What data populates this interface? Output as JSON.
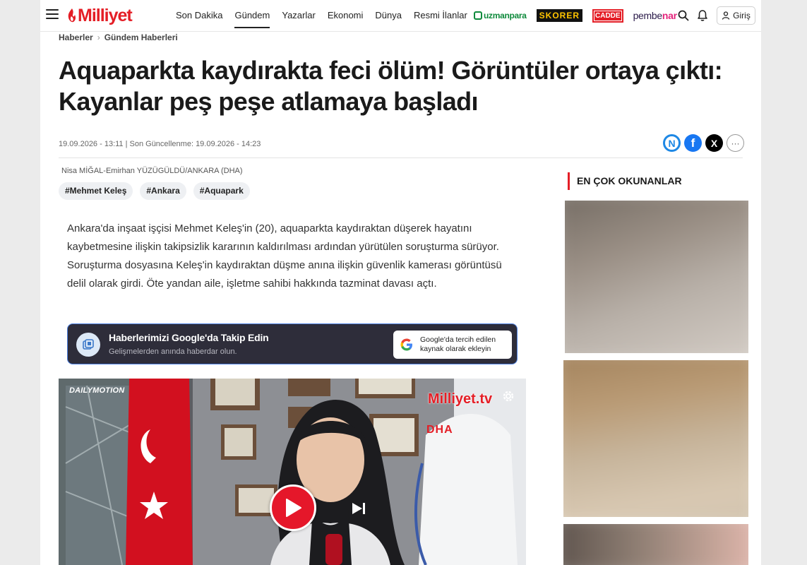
{
  "header": {
    "logo_text": "Milliyet",
    "nav": [
      "Son Dakika",
      "Gündem",
      "Yazarlar",
      "Ekonomi",
      "Dünya",
      "Resmi İlanlar"
    ],
    "active_nav": "Gündem",
    "brands": {
      "uzmanpara": "uzmanpara",
      "skorer": "SKORER",
      "cadde": "CADDE",
      "pembenar_a": "pembe",
      "pembenar_b": "nar"
    },
    "login_label": "Giriş"
  },
  "breadcrumb": [
    "Haberler",
    "Gündem Haberleri"
  ],
  "article": {
    "title": "Aquaparkta kaydırakta feci ölüm! Görüntüler ortaya çıktı: Kayanlar peş peşe atlamaya başladı",
    "meta": "19.09.2026 - 13:11 | Son Güncellenme: 19.09.2026 - 14:23",
    "byline": "Nisa MİĞAL-Emirhan YÜZÜGÜLDÜ/ANKARA (DHA)",
    "tags": [
      "#Mehmet Keleş",
      "#Ankara",
      "#Aquapark"
    ],
    "lead": "Ankara'da inşaat işçisi Mehmet Keleş'in (20), aquaparkta kaydıraktan düşerek hayatını kaybetmesine ilişkin takipsizlik kararının kaldırılması ardından yürütülen soruşturma sürüyor. Soruşturma dosyasına Keleş'in kaydıraktan düşme anına ilişkin güvenlik kamerası görüntüsü delil olarak girdi. Öte yandan aile, işletme sahibi hakkında tazminat davası açtı."
  },
  "share": {
    "n_label": "N",
    "fb_label": "f",
    "x_label": "X",
    "more_label": "···"
  },
  "google_banner": {
    "title": "Haberlerimizi Google'da Takip Edin",
    "subtitle": "Gelişmelerden anında haberdar olun.",
    "button_line1": "Google'da tercih edilen",
    "button_line2": "kaynak olarak ekleyin"
  },
  "video": {
    "provider": "DAILYMOTION",
    "channel_logo": "Milliyet.tv",
    "agency": "DHA"
  },
  "sidebar": {
    "title": "EN ÇOK OKUNANLAR"
  },
  "colors": {
    "brand_red": "#e41e26",
    "banner_bg": "#2e2d3a",
    "tag_bg": "#eef0f3"
  }
}
